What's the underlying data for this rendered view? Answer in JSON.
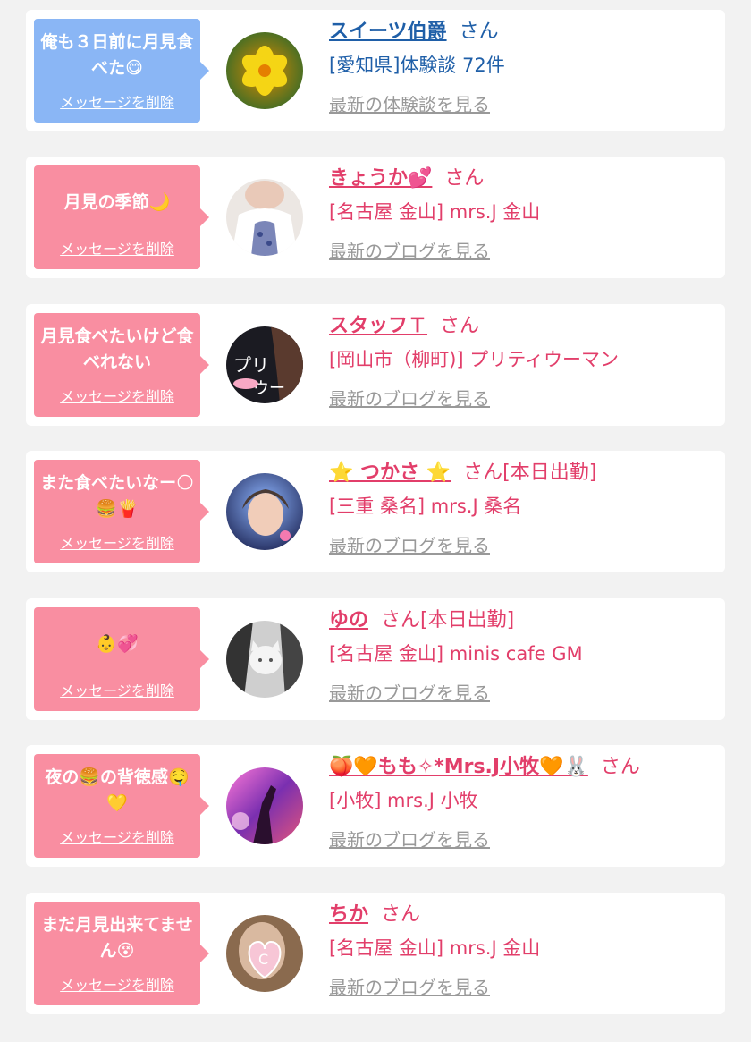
{
  "colors": {
    "blue_bubble": "#8ab6f5",
    "pink_bubble": "#f98ea1",
    "blue_text": "#1f5fa8",
    "pink_text": "#e23e6a",
    "gray_link": "#999999"
  },
  "cards": [
    {
      "theme": "blue",
      "message": "俺も３日前に月見食べた😋",
      "delete_label": "メッセージを削除",
      "avatar_icon": "yellow-flower-photo",
      "name": "スイーツ伯爵",
      "suffix": "さん",
      "location": "[愛知県]体験談 72件",
      "link_label": "最新の体験談を見る"
    },
    {
      "theme": "pink",
      "message": "月見の季節🌙",
      "delete_label": "メッセージを削除",
      "avatar_icon": "woman-white-blouse-photo",
      "name": "きょうか💕",
      "suffix": "さん",
      "location": "[名古屋 金山] mrs.J 金山",
      "link_label": "最新のブログを見る"
    },
    {
      "theme": "pink",
      "message": "月見食べたいけど食べれない",
      "delete_label": "メッセージを削除",
      "avatar_icon": "pretty-woman-logo-photo",
      "name": "スタッフＴ",
      "suffix": "さん",
      "location": "[岡山市（柳町)] プリティウーマン",
      "link_label": "最新のブログを見る"
    },
    {
      "theme": "pink",
      "message": "また食べたいなー🌕🍔🍟",
      "delete_label": "メッセージを削除",
      "avatar_icon": "woman-portrait-photo",
      "name": "⭐ つかさ ⭐",
      "suffix": "さん[本日出勤]",
      "location": "[三重 桑名] mrs.J 桑名",
      "link_label": "最新のブログを見る"
    },
    {
      "theme": "pink",
      "message": "👶💞",
      "delete_label": "メッセージを削除",
      "avatar_icon": "cat-mask-photo",
      "name": "ゆの",
      "suffix": "さん[本日出勤]",
      "location": "[名古屋 金山] minis cafe GM",
      "link_label": "最新のブログを見る"
    },
    {
      "theme": "pink",
      "message": "夜の🍔の背徳感🤤💛",
      "delete_label": "メッセージを削除",
      "avatar_icon": "neon-silhouette-photo",
      "name": "🍑🧡もも✧*Mrs.J小牧🧡🐰",
      "suffix": "さん",
      "location": "[小牧] mrs.J 小牧",
      "link_label": "最新のブログを見る"
    },
    {
      "theme": "pink",
      "message": "まだ月見出来てません😵",
      "delete_label": "メッセージを削除",
      "avatar_icon": "heart-c-sticker-photo",
      "name": "ちか",
      "suffix": "さん",
      "location": "[名古屋 金山] mrs.J 金山",
      "link_label": "最新のブログを見る"
    }
  ]
}
